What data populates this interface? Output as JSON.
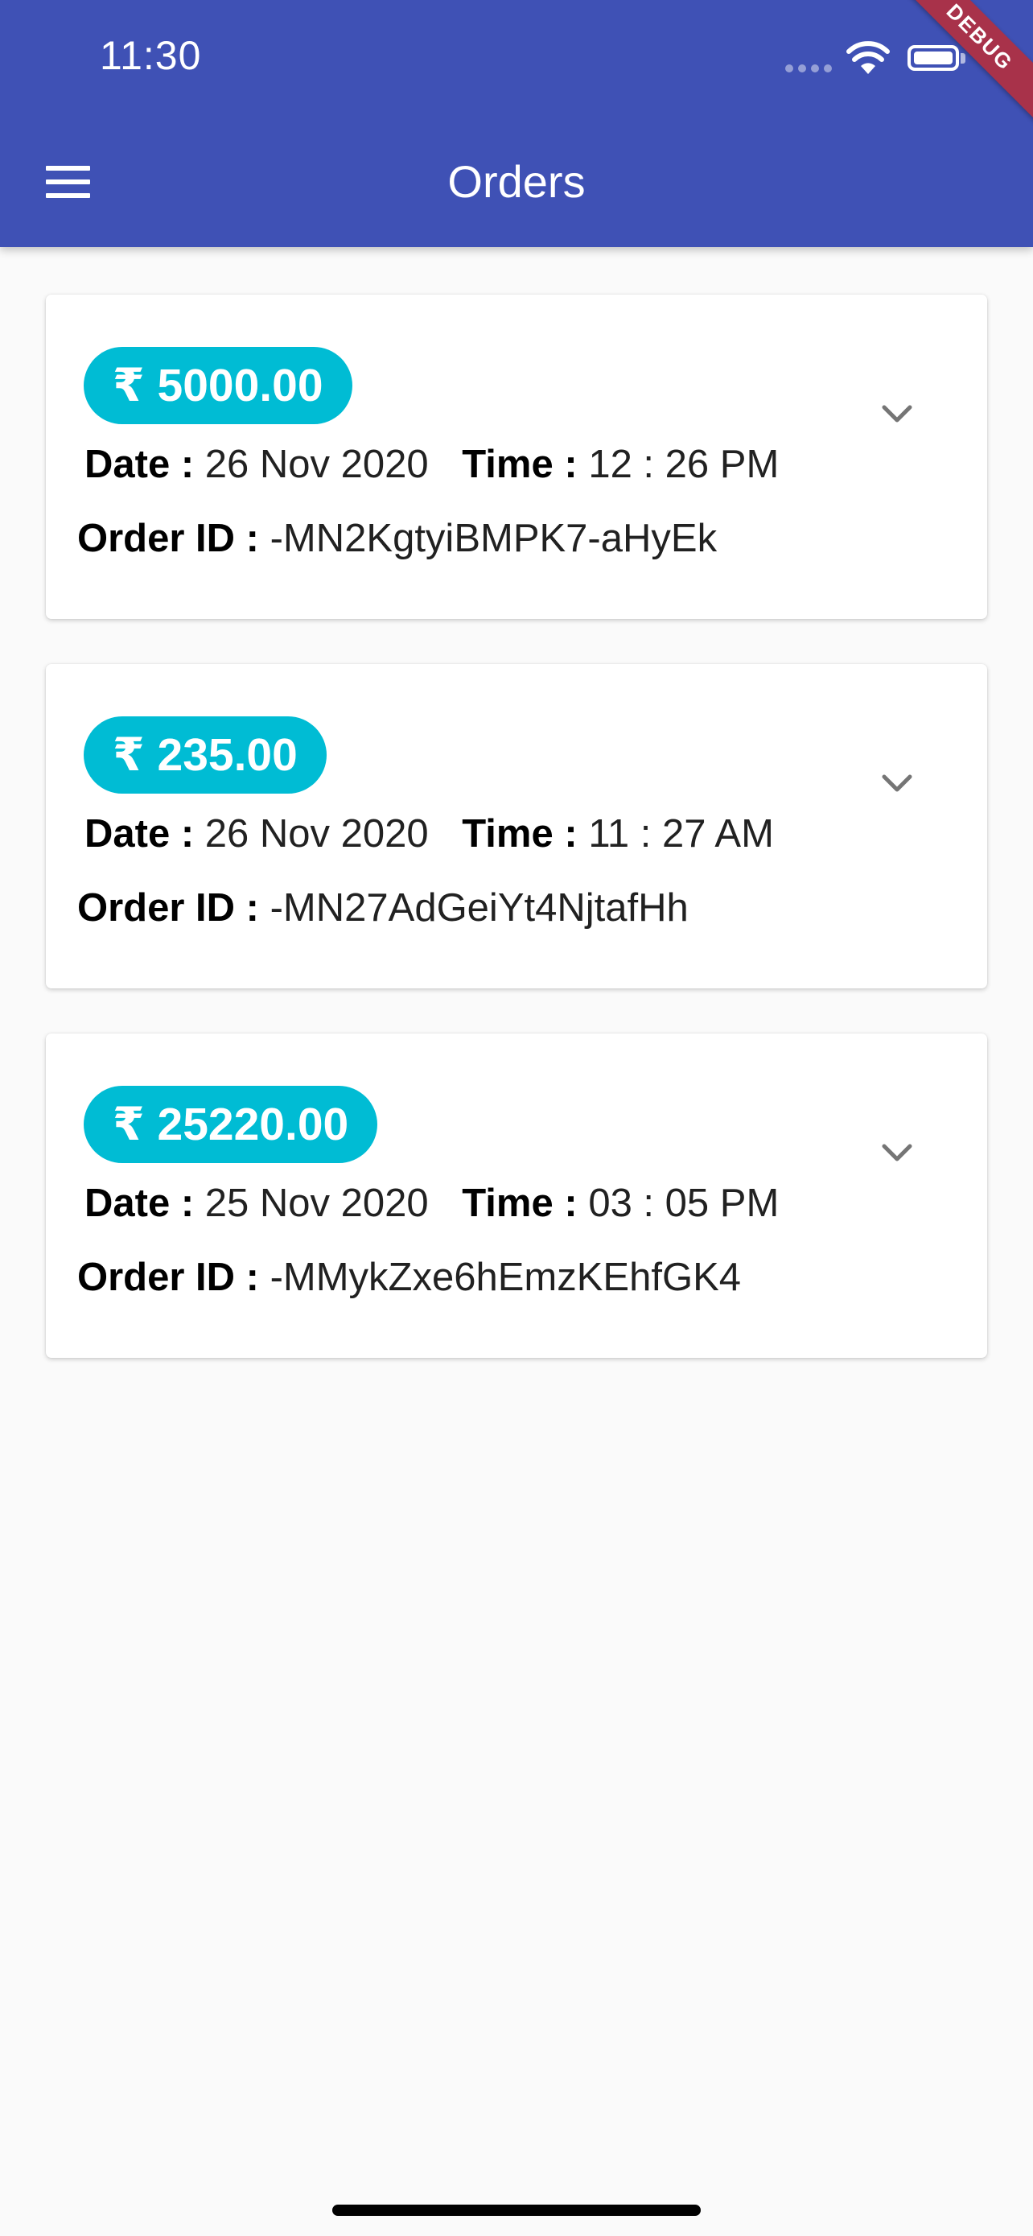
{
  "status_bar": {
    "time": "11:30"
  },
  "app_bar": {
    "title": "Orders",
    "menu_icon": "hamburger-menu-icon",
    "color": "#3f51b5"
  },
  "debug_banner": "DEBUG",
  "labels": {
    "date": "Date :",
    "time": "Time :",
    "order_id": "Order ID :"
  },
  "orders": [
    {
      "amount": "₹ 5000.00",
      "date": "26 Nov 2020",
      "time": "12 : 26 PM",
      "order_id": "-MN2KgtyiBMPK7-aHyEk"
    },
    {
      "amount": "₹ 235.00",
      "date": "26 Nov 2020",
      "time": "11 : 27 AM",
      "order_id": "-MN27AdGeiYt4NjtafHh"
    },
    {
      "amount": "₹ 25220.00",
      "date": "25 Nov 2020",
      "time": "03 : 05 PM",
      "order_id": "-MMykZxe6hEmzKEhfGK4"
    }
  ],
  "colors": {
    "accent": "#00bcd4",
    "background": "#fafafa"
  }
}
